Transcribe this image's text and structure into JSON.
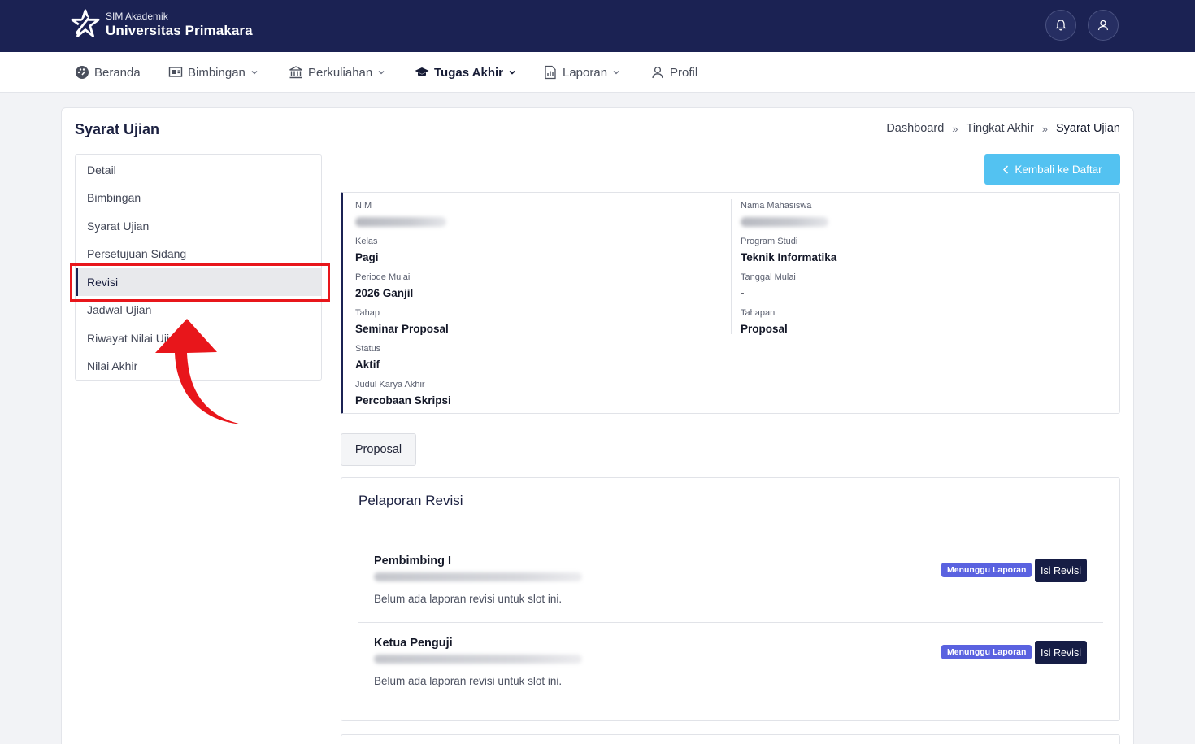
{
  "header": {
    "app_small": "SIM Akademik",
    "app_name": "Universitas Primakara"
  },
  "nav": {
    "items": [
      {
        "label": "Beranda"
      },
      {
        "label": "Bimbingan"
      },
      {
        "label": "Perkuliahan"
      },
      {
        "label": "Tugas Akhir"
      },
      {
        "label": "Laporan"
      },
      {
        "label": "Profil"
      }
    ]
  },
  "page": {
    "title": "Syarat Ujian",
    "breadcrumb": [
      "Dashboard",
      "Tingkat Akhir",
      "Syarat Ujian"
    ],
    "breadcrumb_sep": "»",
    "back_button": "Kembali ke Daftar"
  },
  "sidebar": {
    "items": [
      {
        "label": "Detail"
      },
      {
        "label": "Bimbingan"
      },
      {
        "label": "Syarat Ujian"
      },
      {
        "label": "Persetujuan Sidang"
      },
      {
        "label": "Revisi"
      },
      {
        "label": "Jadwal Ujian"
      },
      {
        "label": "Riwayat Nilai Ujian"
      },
      {
        "label": "Nilai Akhir"
      }
    ],
    "active": "Revisi"
  },
  "info": {
    "nim_label": "NIM",
    "nama_label": "Nama Mahasiswa",
    "kelas_label": "Kelas",
    "kelas_value": "Pagi",
    "prodi_label": "Program Studi",
    "prodi_value": "Teknik Informatika",
    "periode_label": "Periode Mulai",
    "periode_value": "2026 Ganjil",
    "tanggal_label": "Tanggal Mulai",
    "tanggal_value": "-",
    "tahap_label": "Tahap",
    "tahap_value": "Seminar Proposal",
    "tahapan_label": "Tahapan",
    "tahapan_value": "Proposal",
    "status_label": "Status",
    "status_value": "Aktif",
    "judul_label": "Judul Karya Akhir",
    "judul_value": "Percobaan Skripsi"
  },
  "tabs": {
    "proposal": "Proposal"
  },
  "revisi": {
    "heading": "Pelaporan Revisi",
    "slots": [
      {
        "title": "Pembimbing I",
        "note": "Belum ada laporan revisi untuk slot ini.",
        "badge": "Menunggu Laporan",
        "button": "Isi Revisi"
      },
      {
        "title": "Ketua Penguji",
        "note": "Belum ada laporan revisi untuk slot ini.",
        "badge": "Menunggu Laporan",
        "button": "Isi Revisi"
      }
    ]
  },
  "colors": {
    "header_bg": "#1b2253",
    "accent_button": "#53c2f1",
    "badge": "#5a62e0",
    "primary_button": "#161d45",
    "annotation": "#e8161b"
  }
}
